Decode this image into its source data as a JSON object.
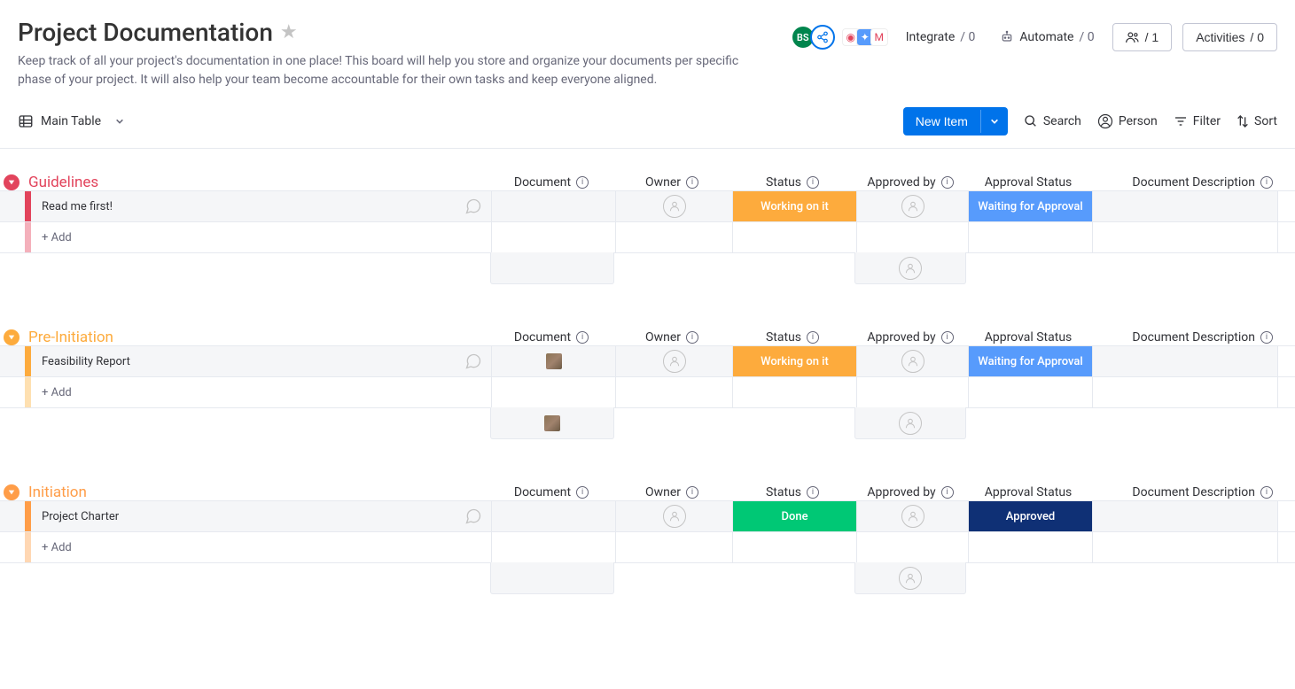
{
  "board": {
    "title": "Project Documentation",
    "description": "Keep track of all your project's documentation in one place! This board will help you store and organize your documents per specific phase of your project. It will also help your team become accountable for their own tasks and keep everyone aligned."
  },
  "header": {
    "avatar_initials": "BS",
    "integrate_label": "Integrate",
    "integrate_count": "/ 0",
    "automate_label": "Automate",
    "automate_count": "/ 0",
    "members_count": "/ 1",
    "activities_label": "Activities",
    "activities_count": "/ 0"
  },
  "toolbar": {
    "view_label": "Main Table",
    "new_item_label": "New Item",
    "search_label": "Search",
    "person_label": "Person",
    "filter_label": "Filter",
    "sort_label": "Sort"
  },
  "columns": {
    "document": "Document",
    "owner": "Owner",
    "status": "Status",
    "approved_by": "Approved by",
    "approval_status": "Approval Status",
    "doc_desc": "Document Description"
  },
  "common": {
    "add_label": "+ Add"
  },
  "groups": [
    {
      "title": "Guidelines",
      "color": "#e2445c",
      "color_light": "#f4b0bb",
      "items": [
        {
          "name": "Read me first!",
          "has_doc_thumb": false,
          "status": "Working on it",
          "status_class": "st-orange",
          "approval_status": "Waiting for Approval",
          "approval_class": "st-blue"
        }
      ]
    },
    {
      "title": "Pre-Initiation",
      "color": "#fdab3d",
      "color_light": "#fee0b1",
      "items": [
        {
          "name": "Feasibility Report",
          "has_doc_thumb": true,
          "status": "Working on it",
          "status_class": "st-orange",
          "approval_status": "Waiting for Approval",
          "approval_class": "st-blue"
        }
      ]
    },
    {
      "title": "Initiation",
      "color": "#ff9d48",
      "color_light": "#ffd7b3",
      "items": [
        {
          "name": "Project Charter",
          "has_doc_thumb": false,
          "status": "Done",
          "status_class": "st-green",
          "approval_status": "Approved",
          "approval_class": "st-navy"
        }
      ]
    }
  ]
}
